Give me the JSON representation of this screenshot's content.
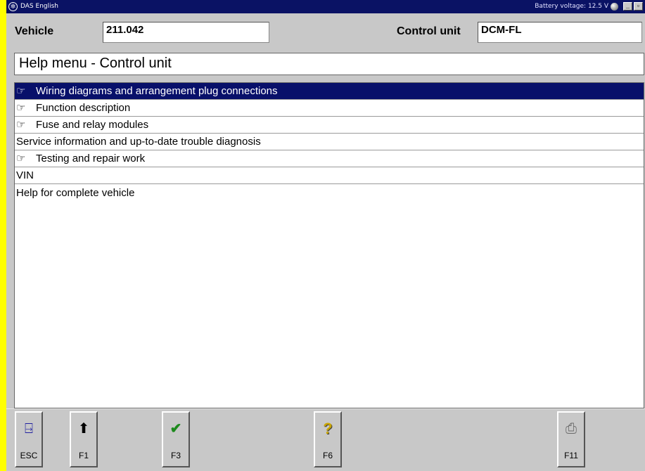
{
  "window": {
    "title": "DAS English",
    "battery_text": "Battery voltage: 12.5 V",
    "minimize_glyph": "_",
    "restore_glyph": "▫"
  },
  "header": {
    "vehicle_label": "Vehicle",
    "vehicle_value": "211.042",
    "control_unit_label": "Control unit",
    "control_unit_value": "DCM-FL"
  },
  "help_title": "Help menu - Control unit",
  "menu": {
    "items": [
      {
        "label": "Wiring diagrams and arrangement plug connections",
        "has_icon": true,
        "selected": true
      },
      {
        "label": "Function description",
        "has_icon": true,
        "selected": false
      },
      {
        "label": "Fuse and relay modules",
        "has_icon": true,
        "selected": false
      },
      {
        "label": "Service information and up-to-date trouble diagnosis",
        "has_icon": false,
        "selected": false
      },
      {
        "label": "Testing and repair work",
        "has_icon": true,
        "selected": false
      },
      {
        "label": "VIN",
        "has_icon": false,
        "selected": false
      },
      {
        "label": "Help for complete vehicle",
        "has_icon": false,
        "selected": false
      }
    ],
    "icon": "pointing-hand-icon"
  },
  "toolbar": {
    "esc": {
      "label": "ESC",
      "icon": "exit-door-icon"
    },
    "f1": {
      "label": "F1",
      "icon": "arrow-up-icon"
    },
    "f3": {
      "label": "F3",
      "icon": "checkmark-icon"
    },
    "f6": {
      "label": "F6",
      "icon": "help-question-icon"
    },
    "f11": {
      "label": "F11",
      "icon": "printer-icon"
    }
  },
  "colors": {
    "titlebar": "#0a1264",
    "selection": "#08106a",
    "left_stripe": "#ffff00",
    "panel": "#c8c8c8"
  }
}
